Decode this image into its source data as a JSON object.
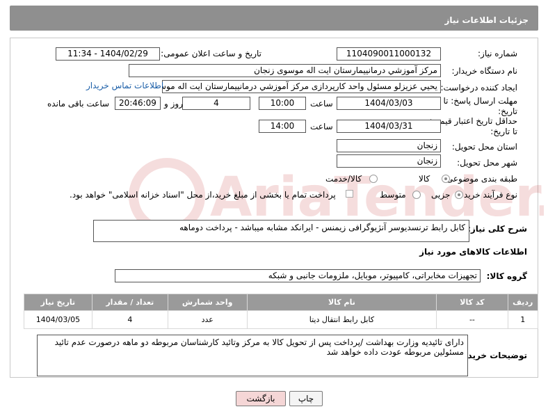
{
  "header": {
    "title": "جزئیات اطلاعات نیاز"
  },
  "fields": {
    "need_number_label": "شماره نیاز:",
    "need_number": "1104090011000132",
    "announce_label": "تاریخ و ساعت اعلان عمومی:",
    "announce_value": "1404/02/29 - 11:34",
    "buyer_org_label": "نام دستگاه خریدار:",
    "buyer_org": "مرکز آموزشي درمانييمارستان ايت اله موسوی زنجان",
    "requester_label": "ایجاد کننده درخواست:",
    "requester": "يحيي عزيزلو مسئول واحد کارپردازی مرکز آموزشي درمانييمارستان ايت اله موسوی",
    "buyer_contact_link": "اطلاعات تماس خریدار",
    "deadline_label_1": "مهلت ارسال پاسخ: تا",
    "deadline_label_2": "تاریخ:",
    "deadline_date": "1404/03/03",
    "time_label": "ساعت",
    "deadline_time": "10:00",
    "days_value": "4",
    "days_label": "روز و",
    "remaining_time": "20:46:09",
    "remaining_label": "ساعت باقی مانده",
    "validity_label_1": "حداقل تاریخ اعتبار قیمت:",
    "validity_label_2": "تا تاریخ:",
    "validity_date": "1404/03/31",
    "validity_time": "14:00",
    "province_label": "استان محل تحویل:",
    "province": "زنجان",
    "city_label": "شهر محل تحویل:",
    "city": "زنجان",
    "category_label": "طبقه بندی موضوعی:",
    "category_options": [
      "کالا",
      "کالا/خدمت"
    ],
    "category_selected": "کالا",
    "process_label": "نوع فرآیند خرید :",
    "process_options": [
      "جزیی",
      "متوسط"
    ],
    "process_selected": "جزیی",
    "payment_note": "پرداخت تمام یا بخشی از مبلغ خرید،از محل \"اسناد خزانه اسلامی\" خواهد بود.",
    "summary_label": "شرح کلی نیاز:",
    "summary": "کابل رابط ترنسدیوسر آنژیوگرافی زیمنس - ایرانکد مشابه میباشد - پرداخت دوماهه"
  },
  "goods": {
    "section_title": "اطلاعات کالاهای مورد نیاز",
    "group_label": "گروه کالا:",
    "group_value": "تجهیزات مخابراتی، کامپیوتر، موبایل، ملزومات جانبی و شبکه",
    "columns": [
      "ردیف",
      "کد کالا",
      "نام کالا",
      "واحد شمارش",
      "تعداد / مقدار",
      "تاریخ نیاز"
    ],
    "rows": [
      {
        "index": "1",
        "code": "--",
        "name": "کابل رابط انتقال دیتا",
        "unit": "عدد",
        "qty": "4",
        "date": "1404/03/05"
      }
    ]
  },
  "buyer_notes": {
    "label": "توضیحات خریدار:",
    "text": "دارای تائیدیه وزارت بهداشت /پرداخت پس از تحویل کالا به مرکز وتائید کارشناسان مربوطه دو ماهه درصورت عدم تائید مسئولین مربوطه عودت داده خواهد شد"
  },
  "buttons": {
    "print": "چاپ",
    "back": "بازگشت"
  },
  "watermark": {
    "text": "AriaTender.net"
  },
  "colors": {
    "header_bg": "#8f8f8f",
    "table_header_bg": "#9a9a9a",
    "back_button_bg": "#f5d6d6",
    "link": "#1a5ea8"
  }
}
